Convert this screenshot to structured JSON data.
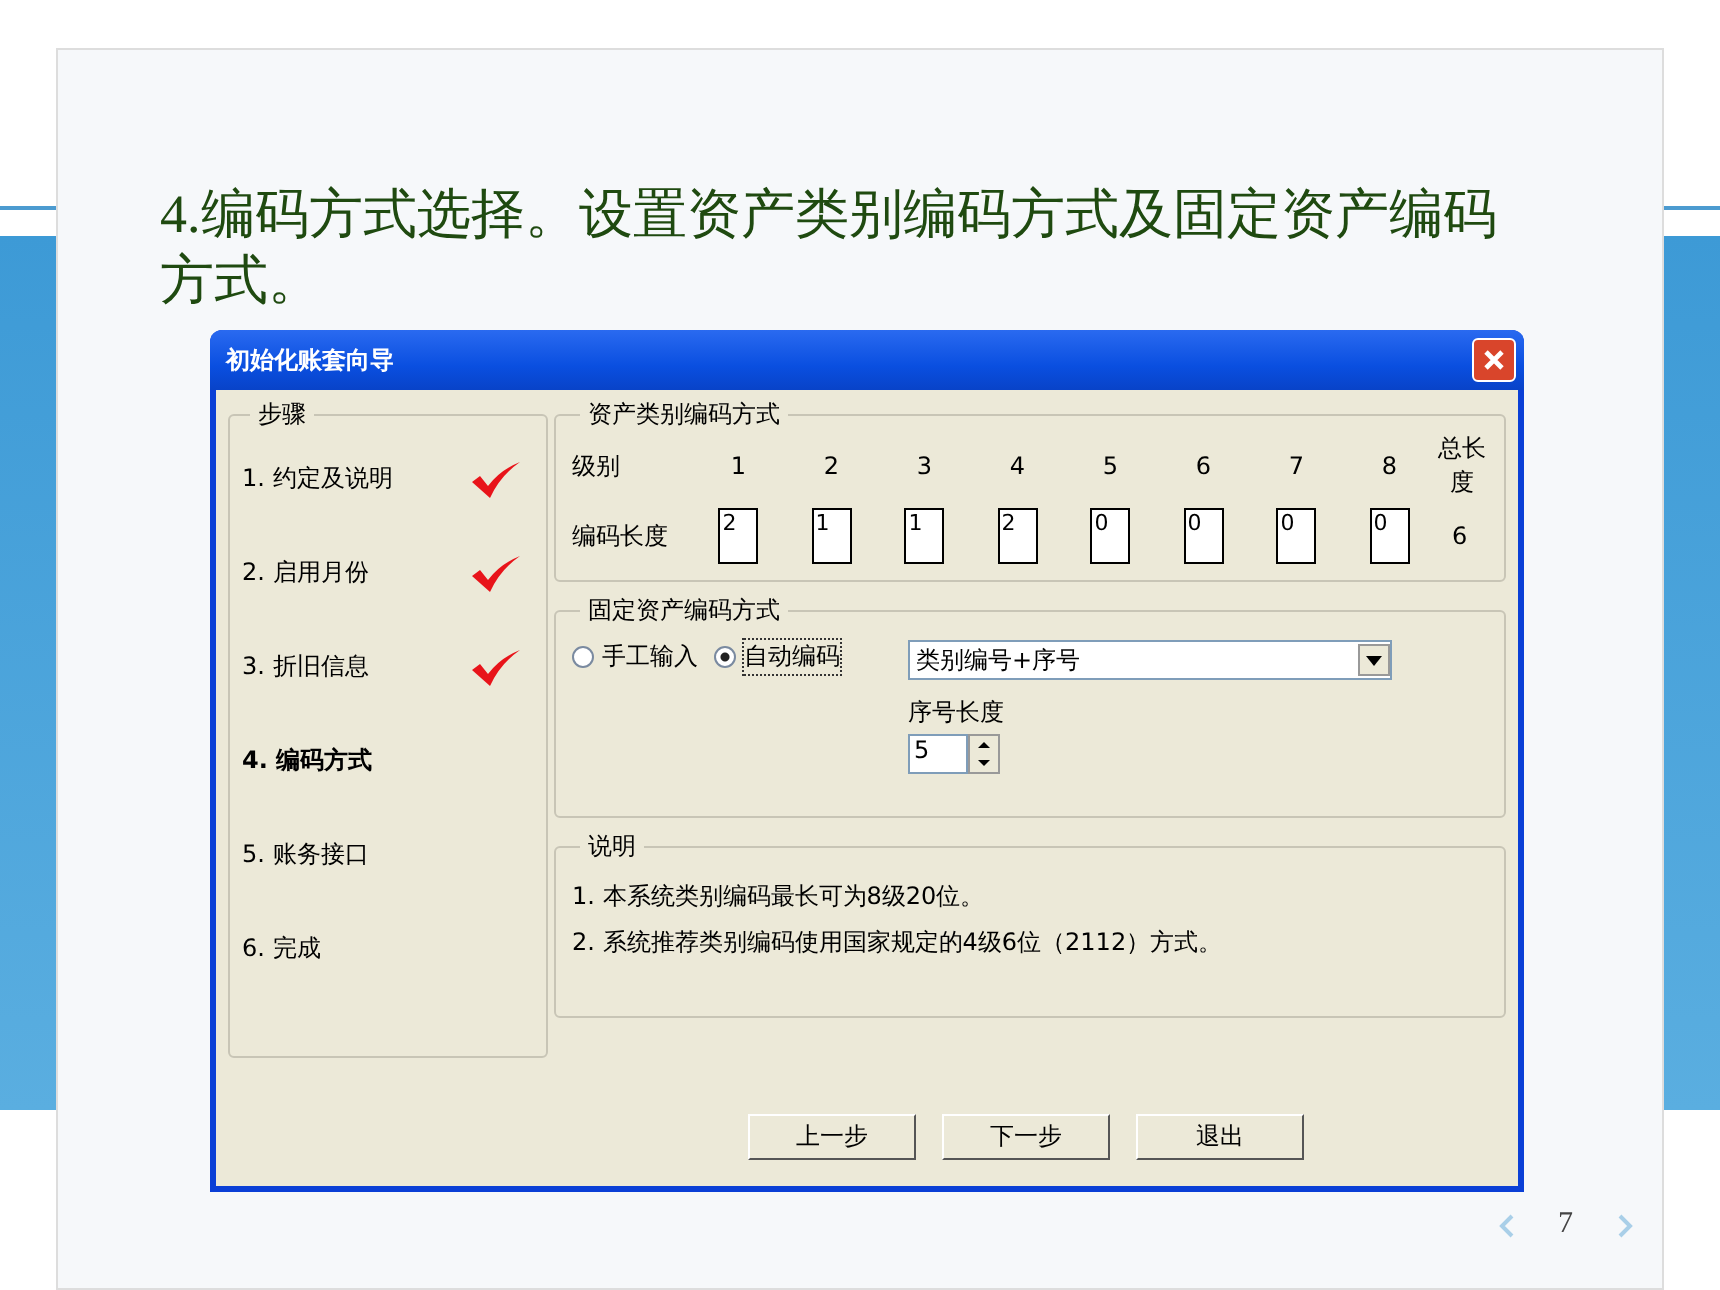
{
  "slide": {
    "title": "4.编码方式选择。设置资产类别编码方式及固定资产编码方式。",
    "page_number": "7"
  },
  "dialog": {
    "title": "初始化账套向导"
  },
  "steps": {
    "legend": "步骤",
    "items": [
      {
        "label": "1. 约定及说明",
        "done": true,
        "selected": false
      },
      {
        "label": "2. 启用月份",
        "done": true,
        "selected": false
      },
      {
        "label": "3. 折旧信息",
        "done": true,
        "selected": false
      },
      {
        "label": "4. 编码方式",
        "done": false,
        "selected": true
      },
      {
        "label": "5. 账务接口",
        "done": false,
        "selected": false
      },
      {
        "label": "6. 完成",
        "done": false,
        "selected": false
      }
    ]
  },
  "category_coding": {
    "legend": "资产类别编码方式",
    "level_label": "级别",
    "length_label": "编码长度",
    "total_label": "总长度",
    "total": "6",
    "levels": [
      {
        "level": "1",
        "length": "2"
      },
      {
        "level": "2",
        "length": "1"
      },
      {
        "level": "3",
        "length": "1"
      },
      {
        "level": "4",
        "length": "2"
      },
      {
        "level": "5",
        "length": "0"
      },
      {
        "level": "6",
        "length": "0"
      },
      {
        "level": "7",
        "length": "0"
      },
      {
        "level": "8",
        "length": "0"
      }
    ]
  },
  "asset_coding": {
    "legend": "固定资产编码方式",
    "options": [
      {
        "label": "手工输入",
        "selected": false
      },
      {
        "label": "自动编码",
        "selected": true
      }
    ],
    "scheme": "类别编号+序号",
    "serial_label": "序号长度",
    "serial_length": "5"
  },
  "notes": {
    "legend": "说明",
    "lines": [
      "1. 本系统类别编码最长可为8级20位。",
      "2. 系统推荐类别编码使用国家规定的4级6位（2112）方式。"
    ]
  },
  "buttons": [
    "上一步",
    "下一步",
    "退出"
  ]
}
